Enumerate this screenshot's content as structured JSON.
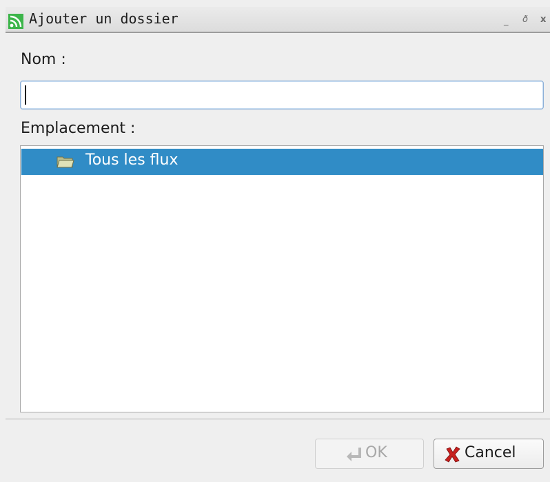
{
  "window": {
    "title": "Ajouter un dossier",
    "controls": {
      "minimize": "_",
      "maximize": "ð",
      "close": "x"
    }
  },
  "form": {
    "name_label": "Nom :",
    "name_value": "",
    "location_label": "Emplacement :"
  },
  "tree": {
    "items": [
      {
        "label": "Tous les flux",
        "selected": true,
        "icon": "folder-open-icon"
      }
    ]
  },
  "buttons": {
    "ok_label": "OK",
    "ok_enabled": false,
    "cancel_label": "Cancel"
  },
  "colors": {
    "selection": "#308cc6",
    "app_icon": "#3cb54a",
    "cancel_icon": "#c8201e"
  }
}
